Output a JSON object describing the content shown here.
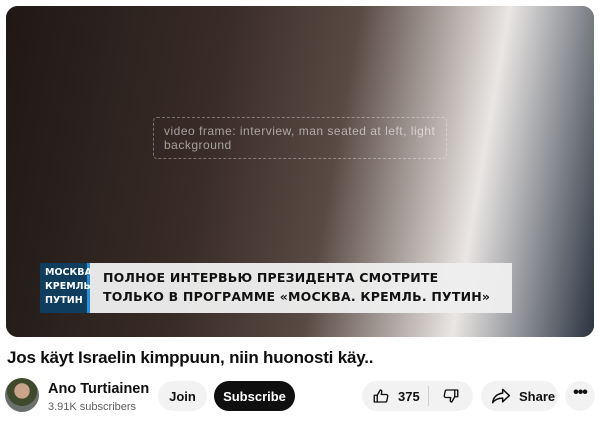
{
  "player": {
    "image_description": "video frame: interview, man seated at left, light background",
    "lower_third": {
      "logo_lines": [
        "МОСКВА",
        "КРЕМЛЬ",
        "ПУТИН"
      ],
      "text_line1": "ПОЛНОЕ ИНТЕРВЬЮ ПРЕЗИДЕНТА СМОТРИТЕ",
      "text_line2": "ТОЛЬКО В ПРОГРАММЕ «МОСКВА. КРЕМЛЬ. ПУТИН»",
      "logo_color": "#0f3d5e",
      "accent_color": "#2c8fd6"
    }
  },
  "video": {
    "title": "Jos käyt Israelin kimppuun, niin huonosti käy.."
  },
  "channel": {
    "name": "Ano Turtiainen",
    "subscribers": "3.91K subscribers",
    "avatar_icon": "channel-avatar"
  },
  "actions": {
    "join_label": "Join",
    "subscribe_label": "Subscribe",
    "like_count": "375",
    "like_icon": "thumbs-up-icon",
    "dislike_icon": "thumbs-down-icon",
    "share_label": "Share",
    "share_icon": "share-arrow-icon",
    "more_label": "•••"
  },
  "colors": {
    "subscribe_bg": "#0f0f0f",
    "pill_bg": "#f2f2f2",
    "secondary_text": "#606060"
  }
}
